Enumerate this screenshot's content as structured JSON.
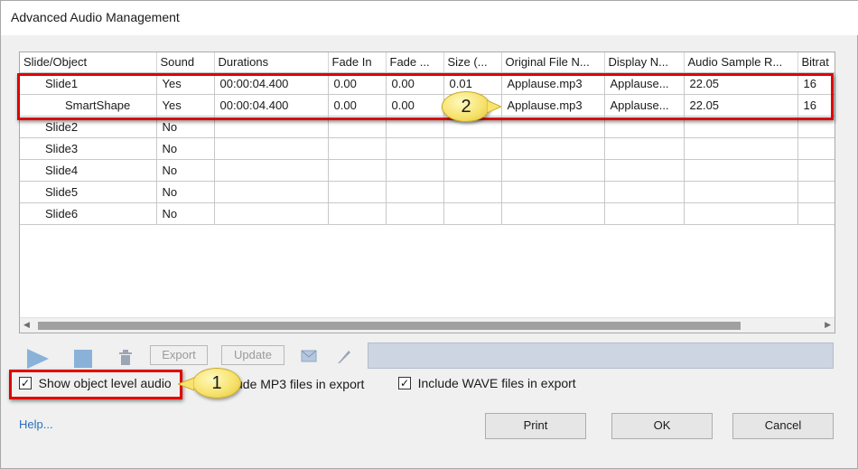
{
  "window": {
    "title": "Advanced Audio Management"
  },
  "grid": {
    "columns": [
      "Slide/Object",
      "Sound",
      "Durations",
      "Fade In",
      "Fade ...",
      "Size (...",
      "Original File N...",
      "Display N...",
      "Audio Sample R...",
      "Bitrat"
    ],
    "rows": [
      {
        "object": "Slide1",
        "sound": "Yes",
        "duration": "00:00:04.400",
        "fade_in": "0.00",
        "fade_out": "0.00",
        "size": "0.01",
        "original_file": "Applause.mp3",
        "display_name": "Applause...",
        "sample_rate": "22.05",
        "bitrate": "16"
      },
      {
        "object": "SmartShape",
        "sound": "Yes",
        "duration": "00:00:04.400",
        "fade_in": "0.00",
        "fade_out": "0.00",
        "size": "",
        "original_file": "Applause.mp3",
        "display_name": "Applause...",
        "sample_rate": "22.05",
        "bitrate": "16"
      },
      {
        "object": "Slide2",
        "sound": "No",
        "duration": "",
        "fade_in": "",
        "fade_out": "",
        "size": "",
        "original_file": "",
        "display_name": "",
        "sample_rate": "",
        "bitrate": ""
      },
      {
        "object": "Slide3",
        "sound": "No",
        "duration": "",
        "fade_in": "",
        "fade_out": "",
        "size": "",
        "original_file": "",
        "display_name": "",
        "sample_rate": "",
        "bitrate": ""
      },
      {
        "object": "Slide4",
        "sound": "No",
        "duration": "",
        "fade_in": "",
        "fade_out": "",
        "size": "",
        "original_file": "",
        "display_name": "",
        "sample_rate": "",
        "bitrate": ""
      },
      {
        "object": "Slide5",
        "sound": "No",
        "duration": "",
        "fade_in": "",
        "fade_out": "",
        "size": "",
        "original_file": "",
        "display_name": "",
        "sample_rate": "",
        "bitrate": ""
      },
      {
        "object": "Slide6",
        "sound": "No",
        "duration": "",
        "fade_in": "",
        "fade_out": "",
        "size": "",
        "original_file": "",
        "display_name": "",
        "sample_rate": "",
        "bitrate": ""
      }
    ]
  },
  "toolbar": {
    "export_label": "Export",
    "update_label": "Update",
    "icons": [
      "play-icon",
      "stop-icon",
      "trash-icon",
      "envelope-icon",
      "pencil-icon"
    ]
  },
  "options": {
    "show_object_level": {
      "label": "Show object level audio",
      "checked": true
    },
    "include_mp3": {
      "label": "ude MP3 files in export",
      "checked": true
    },
    "include_wave": {
      "label": "Include WAVE files in export",
      "checked": true
    }
  },
  "callouts": {
    "one": "1",
    "two": "2"
  },
  "footer": {
    "help_label": "Help...",
    "print_label": "Print",
    "ok_label": "OK",
    "cancel_label": "Cancel"
  },
  "colors": {
    "highlight_border": "#e00000",
    "callout_fill": "#f7e36e",
    "link": "#2a6fbd"
  }
}
